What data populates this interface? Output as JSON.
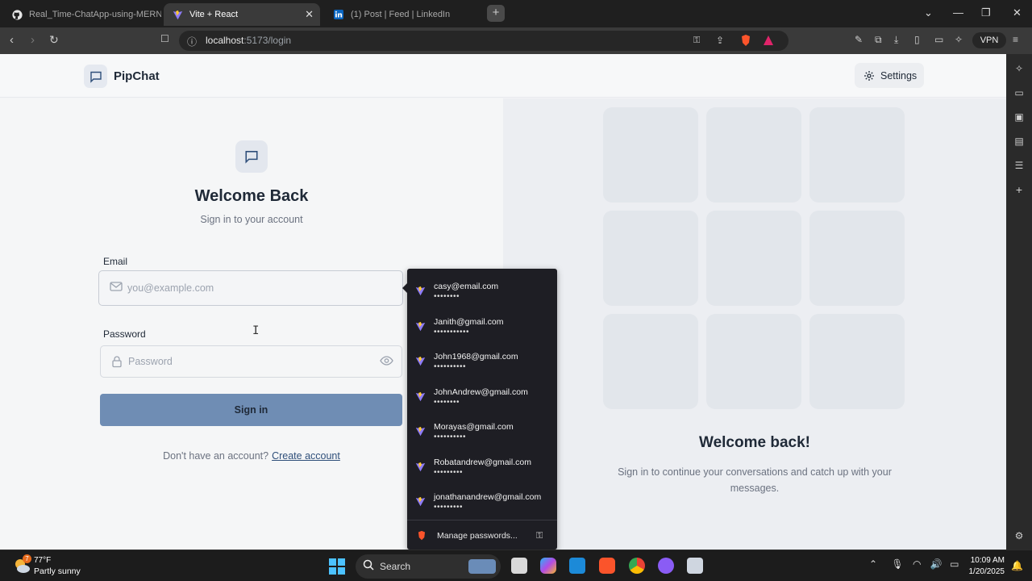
{
  "browser": {
    "tabs": [
      {
        "title": "Real_Time-ChatApp-using-MERN/f",
        "icon": "github-icon",
        "active": false
      },
      {
        "title": "Vite + React",
        "icon": "vite-icon",
        "active": true
      },
      {
        "title": "(1) Post | Feed | LinkedIn",
        "icon": "linkedin-icon",
        "active": false
      }
    ],
    "url_host": "localhost",
    "url_path": ":5173/login",
    "vpn_label": "VPN"
  },
  "app": {
    "brand": "PipChat",
    "settings_label": "Settings",
    "accent_color": "#6f8db4"
  },
  "login": {
    "title": "Welcome Back",
    "subtitle": "Sign in to your account",
    "email_label": "Email",
    "email_placeholder": "you@example.com",
    "password_label": "Password",
    "password_placeholder": "Password",
    "submit_label": "Sign in",
    "signup_prompt": "Don't have an account?",
    "signup_link": "Create account"
  },
  "right_panel": {
    "title": "Welcome back!",
    "subtitle": "Sign in to continue your conversations and catch up with your messages."
  },
  "password_popup": {
    "items": [
      {
        "email": "casy@email.com",
        "dots": "••••••••"
      },
      {
        "email": "Janith@gmail.com",
        "dots": "•••••••••••"
      },
      {
        "email": "John1968@gmail.com",
        "dots": "••••••••••"
      },
      {
        "email": "JohnAndrew@gmail.com",
        "dots": "••••••••"
      },
      {
        "email": "Morayas@gmail.com",
        "dots": "••••••••••"
      },
      {
        "email": "Robatandrew@gmail.com",
        "dots": "•••••••••"
      },
      {
        "email": "jonathanandrew@gmail.com",
        "dots": "•••••••••"
      }
    ],
    "manage_label": "Manage passwords..."
  },
  "taskbar": {
    "weather_badge": "7",
    "weather_temp": "77°F",
    "weather_desc": "Partly sunny",
    "search_label": "Search",
    "time": "10:09 AM",
    "date": "1/20/2025"
  }
}
